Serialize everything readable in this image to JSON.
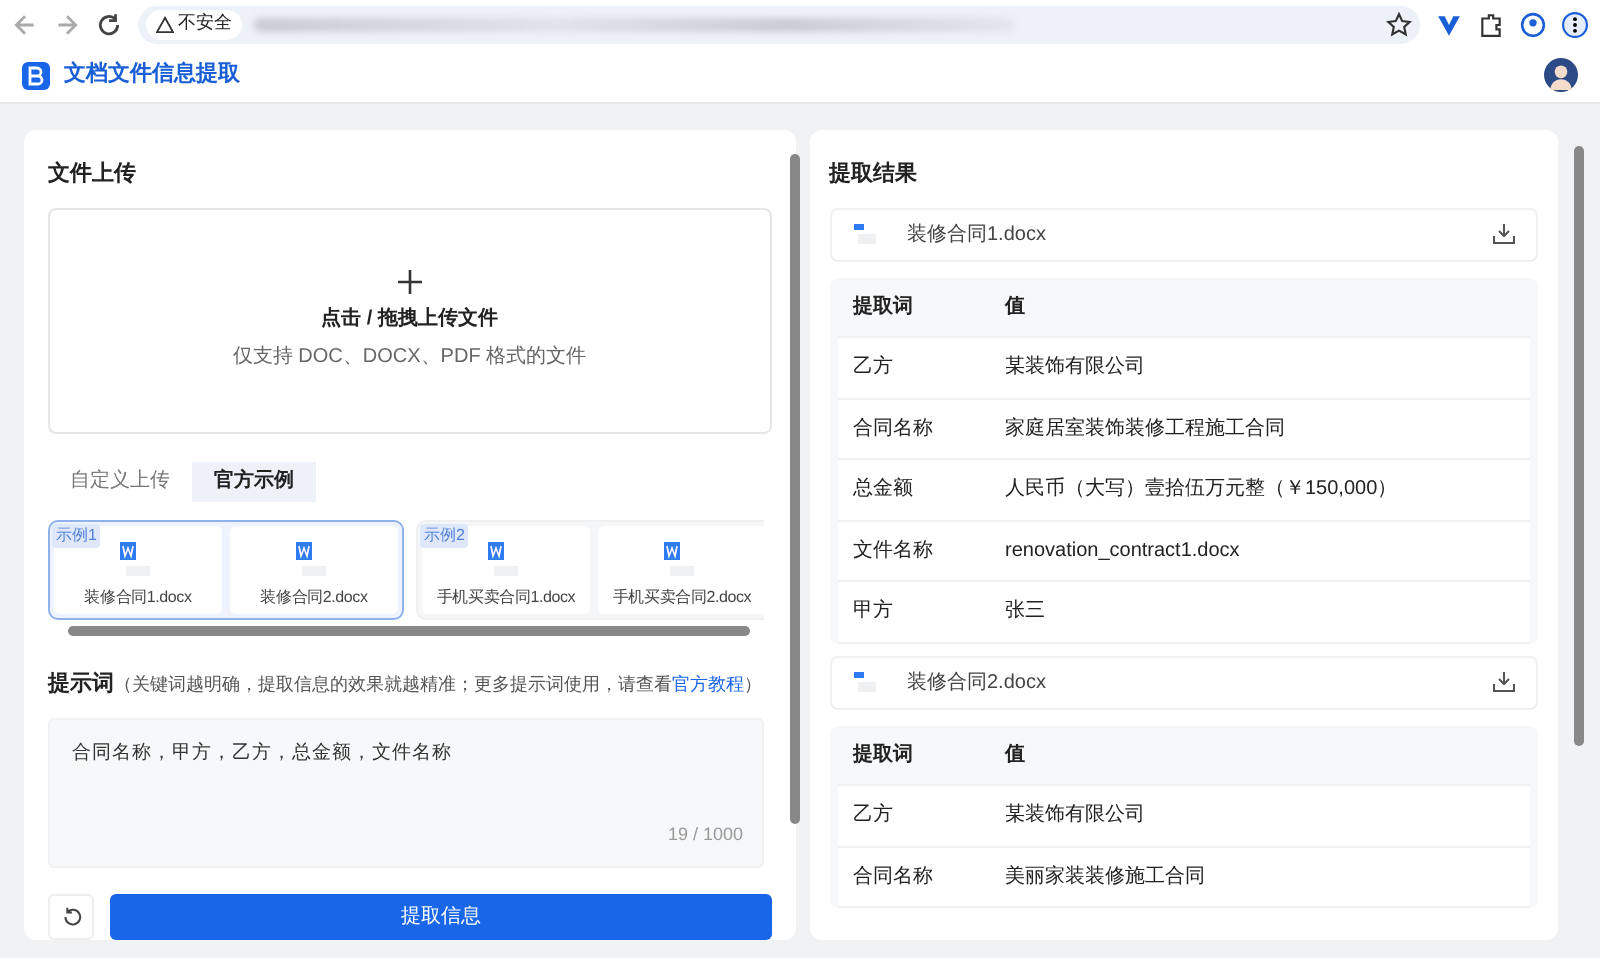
{
  "browser": {
    "security_label": "不安全"
  },
  "app": {
    "title": "文档文件信息提取"
  },
  "upload": {
    "title": "文件上传",
    "drop_title": "点击 / 拖拽上传文件",
    "drop_hint": "仅支持 DOC、DOCX、PDF 格式的文件"
  },
  "tabs": [
    {
      "label": "自定义上传",
      "selected": false
    },
    {
      "label": "官方示例",
      "selected": true
    }
  ],
  "example_groups": [
    {
      "tag": "示例1",
      "selected": true,
      "files": [
        "装修合同1.docx",
        "装修合同2.docx"
      ]
    },
    {
      "tag": "示例2",
      "selected": false,
      "files": [
        "手机买卖合同1.docx",
        "手机买卖合同2.docx"
      ]
    }
  ],
  "prompt": {
    "title": "提示词",
    "hint_before": "（关键词越明确，提取信息的效果就越精准；更多提示词使用，请查看",
    "link": "官方教程",
    "hint_after": "）",
    "value": "合同名称，甲方，乙方，总金额，文件名称",
    "counter": "19 / 1000"
  },
  "submit_button": "提取信息",
  "results": {
    "title": "提取结果",
    "documents": [
      {
        "file": "装修合同1.docx",
        "columns": [
          "提取词",
          "值"
        ],
        "rows": [
          [
            "乙方",
            "某装饰有限公司"
          ],
          [
            "合同名称",
            "家庭居室装饰装修工程施工合同"
          ],
          [
            "总金额",
            "人民币（大写）壹拾伍万元整（￥150,000）"
          ],
          [
            "文件名称",
            "renovation_contract1.docx"
          ],
          [
            "甲方",
            "张三"
          ]
        ]
      },
      {
        "file": "装修合同2.docx",
        "columns": [
          "提取词",
          "值"
        ],
        "rows": [
          [
            "乙方",
            "某装饰有限公司"
          ],
          [
            "合同名称",
            "美丽家装装修施工合同"
          ]
        ]
      }
    ]
  }
}
